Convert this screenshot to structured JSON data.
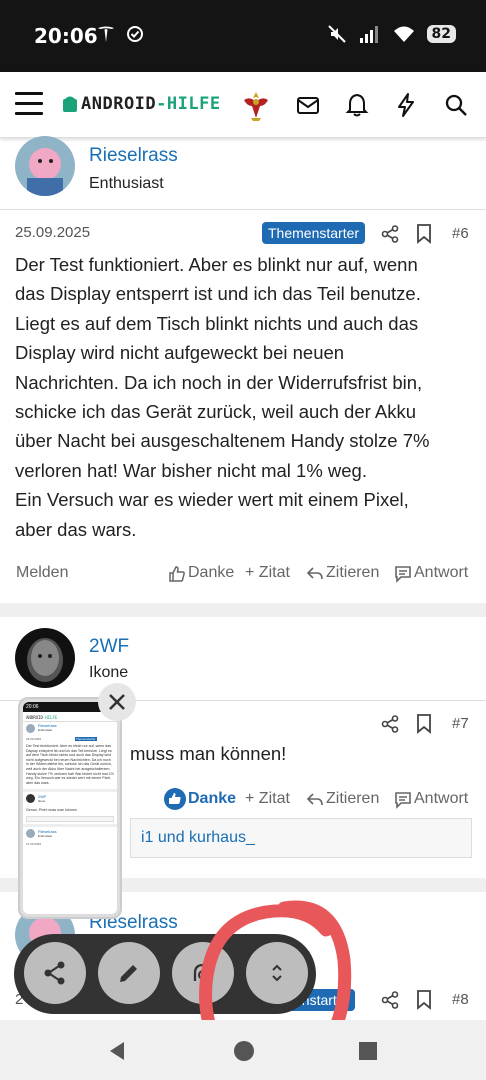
{
  "status_bar": {
    "time": "20:06",
    "battery": "82"
  },
  "app_bar": {
    "logo_part1": "ANDROID",
    "logo_part2": "-HILFE"
  },
  "posts": [
    {
      "username": "Rieselrass",
      "user_title": "Enthusiast",
      "date": "25.09.2025",
      "badge": "Themenstarter",
      "number": "#6",
      "lines": [
        "Der Test funktioniert. Aber es blinkt nur auf, wenn",
        "das Display entsperrt ist und ich das Teil benutze.",
        "Liegt es auf dem Tisch blinkt nichts und auch das",
        "Display wird nicht aufgeweckt bei neuen",
        "Nachrichten. Da ich noch in der Widerrufsfrist bin,",
        "schicke ich das Gerät zurück, weil auch der Akku",
        "über Nacht bei ausgeschaltenem Handy stolze 7%",
        "verloren hat! War bisher nicht mal 1% weg.",
        "Ein Versuch war es wieder wert mit einem Pixel,",
        "aber das wars."
      ],
      "actions": {
        "report": "Melden",
        "thanks": "Danke",
        "quote_add": "+ Zitat",
        "quote": "Zitieren",
        "reply": "Antwort"
      }
    },
    {
      "username": "2WF",
      "user_title": "Ikone",
      "number": "#7",
      "text": "muss man können!",
      "actions": {
        "thanks": "Danke",
        "quote_add": "+ Zitat",
        "quote": "Zitieren",
        "reply": "Antwort"
      },
      "liked_by": "i1 und kurhaus_"
    },
    {
      "username": "Rieselrass",
      "date": "2",
      "badge": "enstarter",
      "number": "#8"
    }
  ],
  "pip": {
    "username": "Rieselrass",
    "user_title": "Enthusiast",
    "date": "25.09.2025",
    "badge": "Themenstarter",
    "text": "Der Test funktioniert. Aber es blinkt nur auf, wenn das Display entsperrt ist und ich das Teil benutze. Liegt es auf dem Tisch blinkt nichts und auch das Display wird nicht aufgeweckt bei neuen Nachrichten. Da ich noch in der Widerrufsfrist bin, schicke ich das Gerät zurück, weil auch der Akku über Nacht bei ausgeschaltenem Handy stolze 7% verloren hat! War bisher nicht mal 1% weg. Ein Versuch war es wieder wert mit einem Pixel, aber das wars.",
    "username2": "2WF",
    "user_title2": "Ikone",
    "text2": "Genau. Pixel muss man können",
    "username3": "Rieselrass",
    "user_title3": "Enthusiast",
    "date3": "27.09.2025"
  },
  "colors": {
    "accent": "#1f6bb3",
    "link": "#1a6fb5",
    "brand_green": "#1aa37a",
    "annotation": "#e8585a"
  }
}
